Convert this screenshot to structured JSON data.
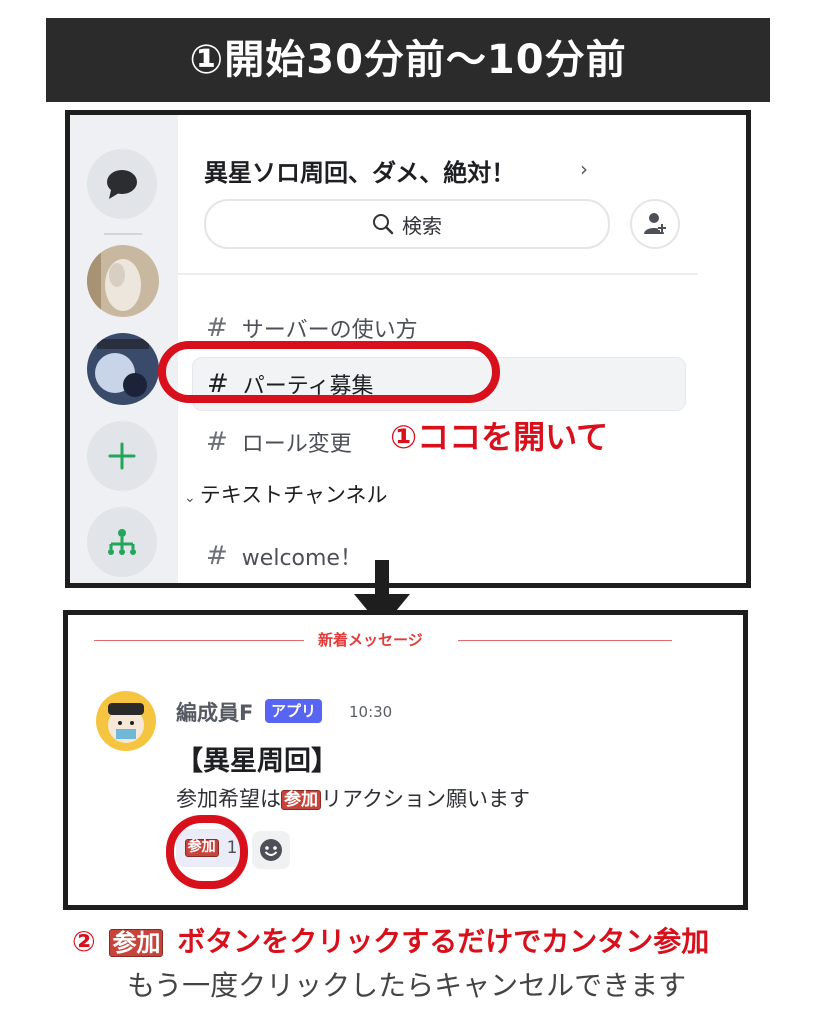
{
  "banner": {
    "title": "①開始30分前〜10分前"
  },
  "server": {
    "title": "異星ソロ周回、ダメ、絶対！",
    "chevron": "›",
    "search_label": "検索"
  },
  "channels": [
    {
      "hash": "#",
      "name": "サーバーの使い方"
    },
    {
      "hash": "#",
      "name": "パーティ募集"
    },
    {
      "hash": "#",
      "name": "ロール変更"
    }
  ],
  "category": {
    "label": "テキストチャンネル",
    "caret": "⌄"
  },
  "category_channels": [
    {
      "hash": "#",
      "name": "welcome！"
    }
  ],
  "annotation_1": "①ココを開いて",
  "message": {
    "new_label": "新着メッセージ",
    "author": "編成員F",
    "badge": "アプリ",
    "time": "10:30",
    "title": "【異星周回】",
    "body_prefix": "参加希望は",
    "emoji_text": "参加",
    "body_suffix": "リアクション願います",
    "reaction_emoji": "参加",
    "reaction_count": "1"
  },
  "caption_2": {
    "num": "②",
    "emoji": "参加",
    "text": "ボタンをクリックするだけでカンタン参加"
  },
  "caption_3": "もう一度クリックしたらキャンセルできます",
  "colors": {
    "accent_red": "#d8101b",
    "badge_blue": "#5865f2",
    "banner_bg": "#2b2b2b"
  }
}
